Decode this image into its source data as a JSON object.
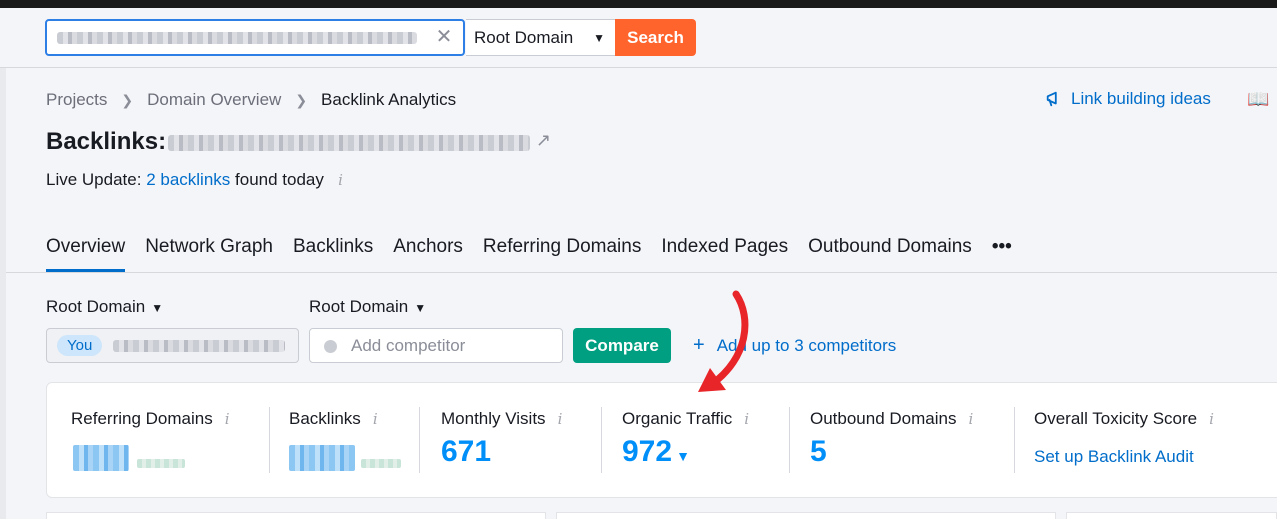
{
  "searchbar": {
    "clear_glyph": "✕",
    "domain_select": "Root Domain",
    "search_label": "Search"
  },
  "breadcrumb": [
    "Projects",
    "Domain Overview",
    "Backlink Analytics"
  ],
  "header_links": {
    "link_building": "Link building ideas"
  },
  "page": {
    "title": "Backlinks:",
    "live_update_prefix": "Live Update:",
    "live_update_link": "2 backlinks",
    "live_update_suffix": "found today"
  },
  "tabs": [
    "Overview",
    "Network Graph",
    "Backlinks",
    "Anchors",
    "Referring Domains",
    "Indexed Pages",
    "Outbound Domains",
    "•••"
  ],
  "compare": {
    "root_domain_1": "Root Domain",
    "root_domain_2": "Root Domain",
    "you_badge": "You",
    "competitor_placeholder": "Add competitor",
    "compare_label": "Compare",
    "add_competitors": "Add up to 3 competitors"
  },
  "metrics": {
    "referring_domains": "Referring Domains",
    "backlinks": "Backlinks",
    "monthly_visits": "Monthly Visits",
    "monthly_visits_value": "671",
    "organic_traffic": "Organic Traffic",
    "organic_traffic_value": "972",
    "outbound_domains": "Outbound Domains",
    "outbound_domains_value": "5",
    "toxicity": "Overall Toxicity Score",
    "toxicity_link": "Set up Backlink Audit"
  },
  "colors": {
    "accent_blue": "#006dca",
    "search_orange": "#ff642d",
    "compare_green": "#009f81",
    "value_blue": "#008ff8",
    "annotation_red": "#e8262a"
  }
}
